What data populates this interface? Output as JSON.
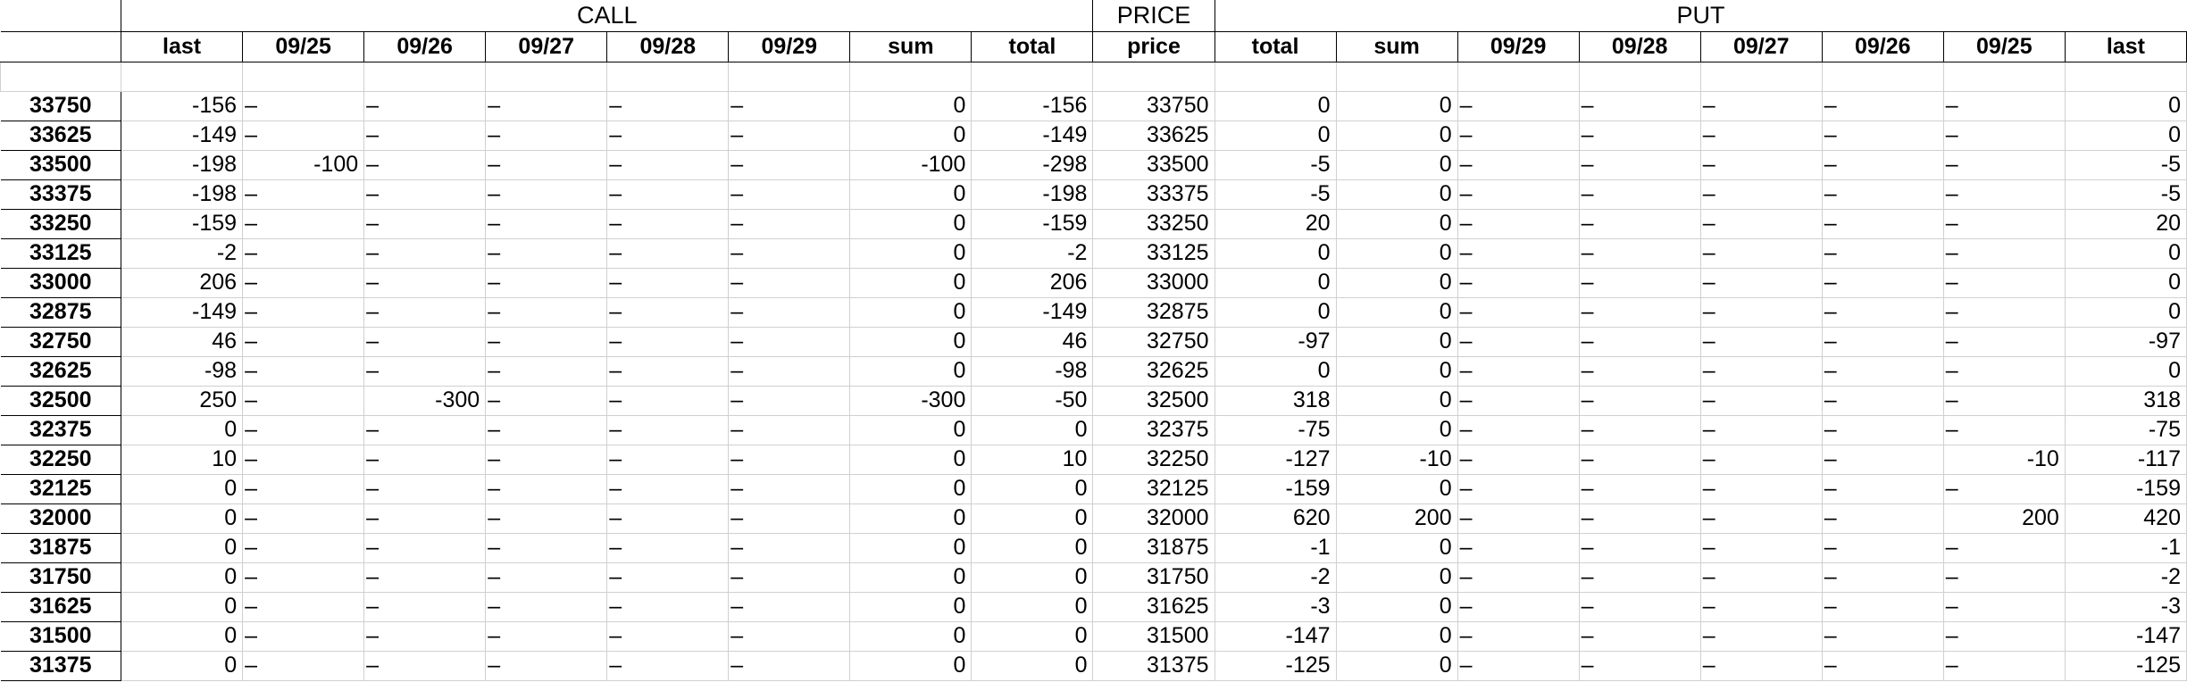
{
  "headers": {
    "group1": [
      "",
      "CALL",
      "PRICE",
      "PUT"
    ],
    "row2": [
      "",
      "last",
      "09/25",
      "09/26",
      "09/27",
      "09/28",
      "09/29",
      "sum",
      "total",
      "price",
      "total",
      "sum",
      "09/29",
      "09/28",
      "09/27",
      "09/26",
      "09/25",
      "last"
    ]
  },
  "rows": [
    [
      "33750",
      "-156",
      "–",
      "–",
      "–",
      "–",
      "–",
      "0",
      "-156",
      "33750",
      "0",
      "0",
      "–",
      "–",
      "–",
      "–",
      "–",
      "0"
    ],
    [
      "33625",
      "-149",
      "–",
      "–",
      "–",
      "–",
      "–",
      "0",
      "-149",
      "33625",
      "0",
      "0",
      "–",
      "–",
      "–",
      "–",
      "–",
      "0"
    ],
    [
      "33500",
      "-198",
      "-100",
      "–",
      "–",
      "–",
      "–",
      "-100",
      "-298",
      "33500",
      "-5",
      "0",
      "–",
      "–",
      "–",
      "–",
      "–",
      "-5"
    ],
    [
      "33375",
      "-198",
      "–",
      "–",
      "–",
      "–",
      "–",
      "0",
      "-198",
      "33375",
      "-5",
      "0",
      "–",
      "–",
      "–",
      "–",
      "–",
      "-5"
    ],
    [
      "33250",
      "-159",
      "–",
      "–",
      "–",
      "–",
      "–",
      "0",
      "-159",
      "33250",
      "20",
      "0",
      "–",
      "–",
      "–",
      "–",
      "–",
      "20"
    ],
    [
      "33125",
      "-2",
      "–",
      "–",
      "–",
      "–",
      "–",
      "0",
      "-2",
      "33125",
      "0",
      "0",
      "–",
      "–",
      "–",
      "–",
      "–",
      "0"
    ],
    [
      "33000",
      "206",
      "–",
      "–",
      "–",
      "–",
      "–",
      "0",
      "206",
      "33000",
      "0",
      "0",
      "–",
      "–",
      "–",
      "–",
      "–",
      "0"
    ],
    [
      "32875",
      "-149",
      "–",
      "–",
      "–",
      "–",
      "–",
      "0",
      "-149",
      "32875",
      "0",
      "0",
      "–",
      "–",
      "–",
      "–",
      "–",
      "0"
    ],
    [
      "32750",
      "46",
      "–",
      "–",
      "–",
      "–",
      "–",
      "0",
      "46",
      "32750",
      "-97",
      "0",
      "–",
      "–",
      "–",
      "–",
      "–",
      "-97"
    ],
    [
      "32625",
      "-98",
      "–",
      "–",
      "–",
      "–",
      "–",
      "0",
      "-98",
      "32625",
      "0",
      "0",
      "–",
      "–",
      "–",
      "–",
      "–",
      "0"
    ],
    [
      "32500",
      "250",
      "–",
      "-300",
      "–",
      "–",
      "–",
      "-300",
      "-50",
      "32500",
      "318",
      "0",
      "–",
      "–",
      "–",
      "–",
      "–",
      "318"
    ],
    [
      "32375",
      "0",
      "–",
      "–",
      "–",
      "–",
      "–",
      "0",
      "0",
      "32375",
      "-75",
      "0",
      "–",
      "–",
      "–",
      "–",
      "–",
      "-75"
    ],
    [
      "32250",
      "10",
      "–",
      "–",
      "–",
      "–",
      "–",
      "0",
      "10",
      "32250",
      "-127",
      "-10",
      "–",
      "–",
      "–",
      "–",
      "-10",
      "-117"
    ],
    [
      "32125",
      "0",
      "–",
      "–",
      "–",
      "–",
      "–",
      "0",
      "0",
      "32125",
      "-159",
      "0",
      "–",
      "–",
      "–",
      "–",
      "–",
      "-159"
    ],
    [
      "32000",
      "0",
      "–",
      "–",
      "–",
      "–",
      "–",
      "0",
      "0",
      "32000",
      "620",
      "200",
      "–",
      "–",
      "–",
      "–",
      "200",
      "420"
    ],
    [
      "31875",
      "0",
      "–",
      "–",
      "–",
      "–",
      "–",
      "0",
      "0",
      "31875",
      "-1",
      "0",
      "–",
      "–",
      "–",
      "–",
      "–",
      "-1"
    ],
    [
      "31750",
      "0",
      "–",
      "–",
      "–",
      "–",
      "–",
      "0",
      "0",
      "31750",
      "-2",
      "0",
      "–",
      "–",
      "–",
      "–",
      "–",
      "-2"
    ],
    [
      "31625",
      "0",
      "–",
      "–",
      "–",
      "–",
      "–",
      "0",
      "0",
      "31625",
      "-3",
      "0",
      "–",
      "–",
      "–",
      "–",
      "–",
      "-3"
    ],
    [
      "31500",
      "0",
      "–",
      "–",
      "–",
      "–",
      "–",
      "0",
      "0",
      "31500",
      "-147",
      "0",
      "–",
      "–",
      "–",
      "–",
      "–",
      "-147"
    ],
    [
      "31375",
      "0",
      "–",
      "–",
      "–",
      "–",
      "–",
      "0",
      "0",
      "31375",
      "-125",
      "0",
      "–",
      "–",
      "–",
      "–",
      "–",
      "-125"
    ]
  ]
}
